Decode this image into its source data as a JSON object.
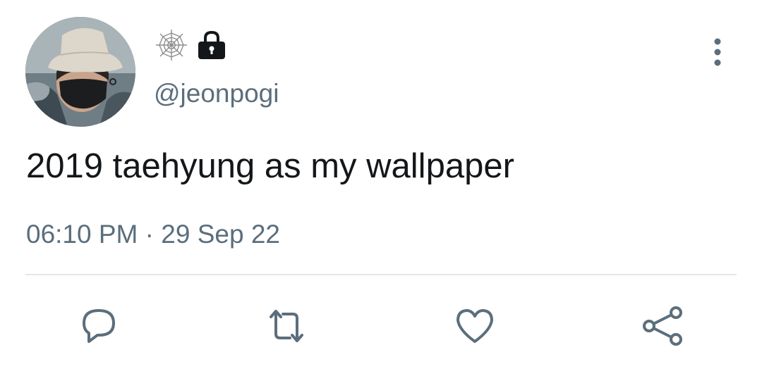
{
  "tweet": {
    "handle": "@jeonpogi",
    "text": "2019 taehyung as my wallpaper",
    "time": "06:10 PM",
    "separator": "·",
    "date": "29 Sep 22"
  },
  "icons": {
    "name_icons": [
      "spiderweb-icon",
      "lock-icon"
    ],
    "more": "more-vertical-icon",
    "actions": [
      "reply-icon",
      "retweet-icon",
      "like-icon",
      "share-icon"
    ]
  },
  "colors": {
    "text": "#14171a",
    "secondary": "#5b6e7c",
    "divider": "#e3e7ea"
  }
}
